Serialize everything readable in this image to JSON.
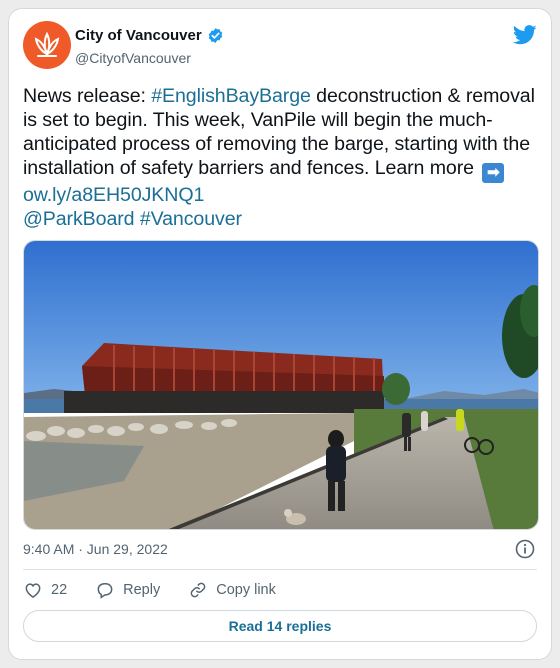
{
  "account": {
    "name": "City of Vancouver",
    "handle": "@CityofVancouver",
    "verified": true
  },
  "tweet": {
    "part1": "News release: ",
    "hashtag1": "#EnglishBayBarge",
    "part2": " deconstruction & removal is set to begin. This week, VanPile will begin the much-anticipated process of removing the barge, starting with the installation of safety barriers and fences. Learn more ",
    "arrow_emoji": "➡",
    "link": "ow.ly/a8EH50JKNQ1",
    "mention": "@ParkBoard",
    "hashtag2": "#Vancouver"
  },
  "timestamp": "9:40 AM · Jun 29, 2022",
  "actions": {
    "likes": "22",
    "reply_label": "Reply",
    "copy_link_label": "Copy link"
  },
  "read_replies_label": "Read 14 replies",
  "colors": {
    "brand_orange": "#f05a28",
    "link_blue": "#1b6f96",
    "twitter_blue": "#1d9bf0"
  }
}
